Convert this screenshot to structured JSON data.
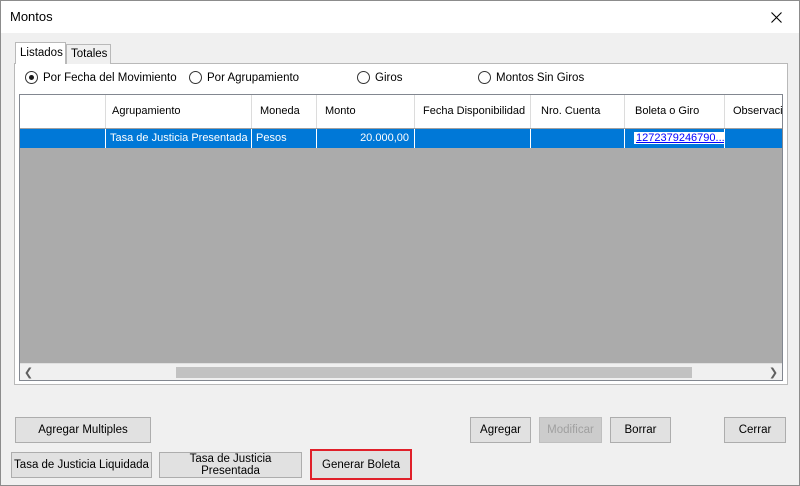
{
  "window": {
    "title": "Montos"
  },
  "tabs": [
    {
      "label": "Listados",
      "active": true
    },
    {
      "label": "Totales",
      "active": false
    }
  ],
  "filters": [
    {
      "label": "Por Fecha del Movimiento",
      "checked": true
    },
    {
      "label": "Por Agrupamiento",
      "checked": false
    },
    {
      "label": "Giros",
      "checked": false
    },
    {
      "label": "Montos Sin Giros",
      "checked": false
    }
  ],
  "grid": {
    "columns": [
      "Agrupamiento",
      "Moneda",
      "Monto",
      "Fecha Disponibilidad",
      "Nro. Cuenta",
      "Boleta o Giro",
      "Observació"
    ],
    "rows": [
      {
        "agrupamiento": "Tasa de Justicia Presentada",
        "moneda": "Pesos",
        "monto": "20.000,00",
        "fecha": "",
        "cuenta": "",
        "boleta": "1272379246790...",
        "observacion": ""
      }
    ]
  },
  "buttons": {
    "agregar_multiples": "Agregar Multiples",
    "agregar": "Agregar",
    "modificar": "Modificar",
    "borrar": "Borrar",
    "cerrar": "Cerrar",
    "tasa_liquidada": "Tasa de Justicia Liquidada",
    "tasa_presentada": "Tasa de Justicia Presentada",
    "generar_boleta": "Generar Boleta"
  },
  "colors": {
    "selection": "#0078d7",
    "highlight_border": "#e0202a",
    "grid_empty": "#ababab"
  }
}
